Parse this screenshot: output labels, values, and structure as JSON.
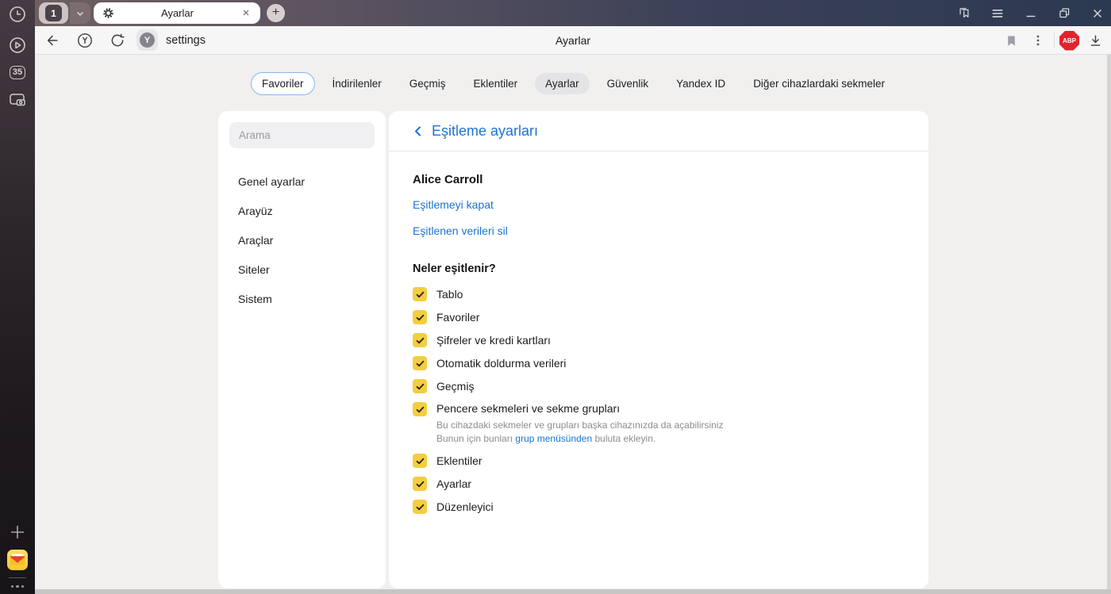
{
  "browser": {
    "tab_bar": {
      "group_count": "1",
      "tab_title": "Ayarlar",
      "new_tab_label": "+"
    },
    "toolbar": {
      "url_text": "settings",
      "page_title": "Ayarlar",
      "favicon_letter": "Y",
      "adblock_badge": "ABP"
    }
  },
  "rail": {
    "tab_count_badge": "35"
  },
  "nav_tabs": {
    "items": [
      {
        "label": "Favoriler",
        "style": "outlined"
      },
      {
        "label": "İndirilenler",
        "style": "plain"
      },
      {
        "label": "Geçmiş",
        "style": "plain"
      },
      {
        "label": "Eklentiler",
        "style": "plain"
      },
      {
        "label": "Ayarlar",
        "style": "selected"
      },
      {
        "label": "Güvenlik",
        "style": "plain"
      },
      {
        "label": "Yandex ID",
        "style": "plain"
      },
      {
        "label": "Diğer cihazlardaki sekmeler",
        "style": "plain"
      }
    ]
  },
  "settings_nav": {
    "search_placeholder": "Arama",
    "items": [
      "Genel ayarlar",
      "Arayüz",
      "Araçlar",
      "Siteler",
      "Sistem"
    ]
  },
  "sync": {
    "title": "Eşitleme ayarları",
    "account_name": "Alice Carroll",
    "turn_off_link": "Eşitlemeyi kapat",
    "delete_data_link": "Eşitlenen verileri sil",
    "section_title": "Neler eşitlenir?",
    "items": [
      "Tablo",
      "Favoriler",
      "Şifreler ve kredi kartları",
      "Otomatik doldurma verileri",
      "Geçmiş",
      "Pencere sekmeleri ve sekme grupları",
      "Eklentiler",
      "Ayarlar",
      "Düzenleyici"
    ],
    "all_checked": true,
    "note_line1": "Bu cihazdaki sekmeler ve grupları başka cihazınızda da açabilirsiniz",
    "note_line2_prefix": "Bunun için bunları ",
    "note_line2_link": "grup menüsünden",
    "note_line2_suffix": " buluta ekleyin."
  },
  "colors": {
    "accent_blue": "#1b74d2",
    "checkbox_yellow": "#f4ce3f",
    "adblock_red": "#e0242e",
    "selected_pill": "#e4e3e5",
    "tabbar_left": "#6f5f5f",
    "tabbar_right": "#2b3951"
  }
}
